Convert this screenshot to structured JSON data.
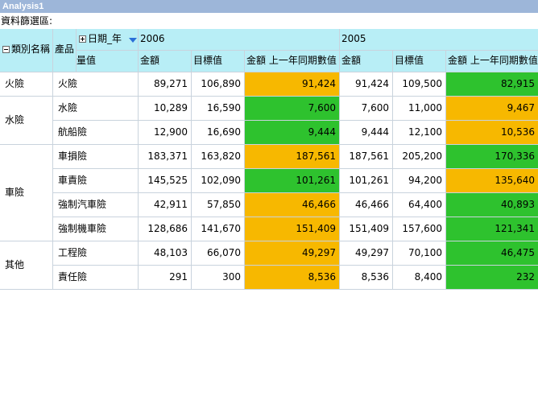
{
  "window": {
    "title": "Analysis1"
  },
  "filter_area": {
    "label": "資料篩選區:"
  },
  "headers": {
    "category": "類別名稱",
    "product": "產品",
    "date_field": "日期_年",
    "measures_field": "量值",
    "year_2006": "2006",
    "year_2005": "2005",
    "amount": "金額",
    "target": "目標值",
    "prev_year": "金額 上一年同期數值"
  },
  "groups": [
    {
      "name": "火險"
    },
    {
      "name": "水險"
    },
    {
      "name": "車險"
    },
    {
      "name": "其他"
    }
  ],
  "rows": [
    {
      "product": "火險",
      "amt2006": "89,271",
      "tgt2006": "106,890",
      "prev2006": "91,424",
      "amt2005": "91,424",
      "tgt2005": "109,500",
      "prev2005": "82,915",
      "c2006": "orange",
      "c2005": "green"
    },
    {
      "product": "水險",
      "amt2006": "10,289",
      "tgt2006": "16,590",
      "prev2006": "7,600",
      "amt2005": "7,600",
      "tgt2005": "11,000",
      "prev2005": "9,467",
      "c2006": "green",
      "c2005": "orange"
    },
    {
      "product": "航船險",
      "amt2006": "12,900",
      "tgt2006": "16,690",
      "prev2006": "9,444",
      "amt2005": "9,444",
      "tgt2005": "12,100",
      "prev2005": "10,536",
      "c2006": "green",
      "c2005": "orange"
    },
    {
      "product": "車損險",
      "amt2006": "183,371",
      "tgt2006": "163,820",
      "prev2006": "187,561",
      "amt2005": "187,561",
      "tgt2005": "205,200",
      "prev2005": "170,336",
      "c2006": "orange",
      "c2005": "green"
    },
    {
      "product": "車責險",
      "amt2006": "145,525",
      "tgt2006": "102,090",
      "prev2006": "101,261",
      "amt2005": "101,261",
      "tgt2005": "94,200",
      "prev2005": "135,640",
      "c2006": "green",
      "c2005": "orange"
    },
    {
      "product": "強制汽車險",
      "amt2006": "42,911",
      "tgt2006": "57,850",
      "prev2006": "46,466",
      "amt2005": "46,466",
      "tgt2005": "64,400",
      "prev2005": "40,893",
      "c2006": "orange",
      "c2005": "green"
    },
    {
      "product": "強制機車險",
      "amt2006": "128,686",
      "tgt2006": "141,670",
      "prev2006": "151,409",
      "amt2005": "151,409",
      "tgt2005": "157,600",
      "prev2005": "121,341",
      "c2006": "orange",
      "c2005": "green"
    },
    {
      "product": "工程險",
      "amt2006": "48,103",
      "tgt2006": "66,070",
      "prev2006": "49,297",
      "amt2005": "49,297",
      "tgt2005": "70,100",
      "prev2005": "46,475",
      "c2006": "orange",
      "c2005": "green"
    },
    {
      "product": "責任險",
      "amt2006": "291",
      "tgt2006": "300",
      "prev2006": "8,536",
      "amt2005": "8,536",
      "tgt2005": "8,400",
      "prev2005": "232",
      "c2006": "orange",
      "c2005": "green"
    }
  ],
  "colors": {
    "header_bg": "#b8eef6",
    "green": "#2ec22e",
    "orange": "#f7b800",
    "title_bg": "#9db6d9"
  },
  "icons": {
    "collapse": "minus-box-icon",
    "expand": "plus-box-icon",
    "filter": "dropdown-arrow-icon"
  }
}
